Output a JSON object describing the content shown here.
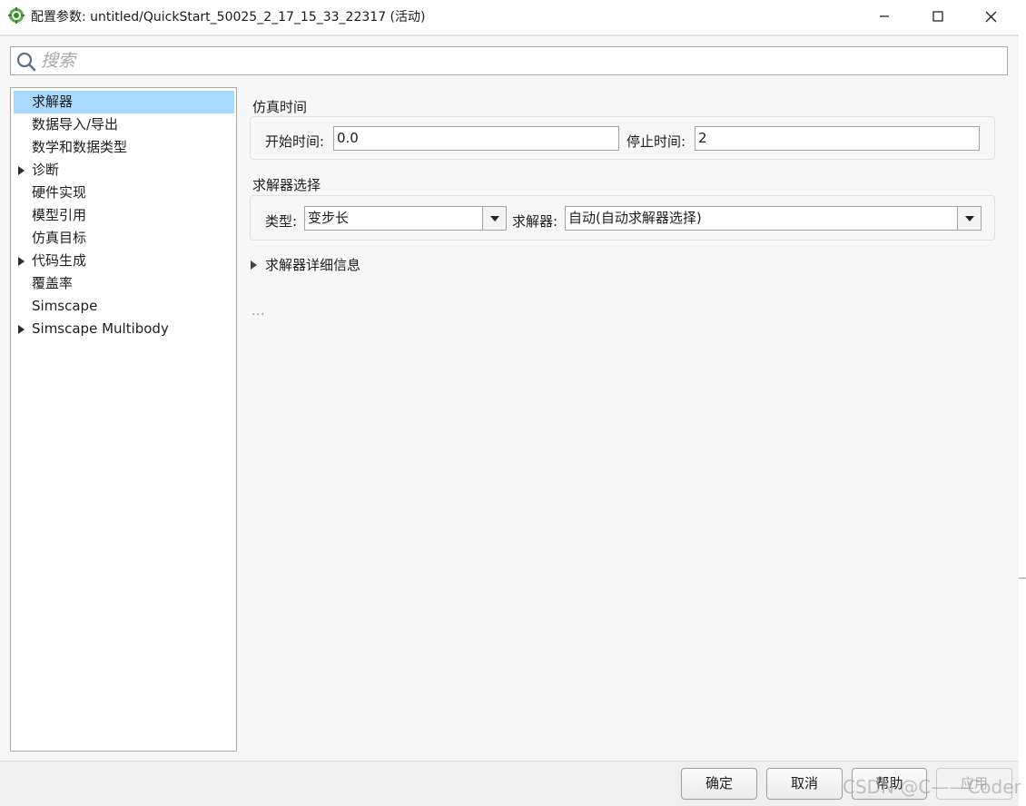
{
  "window": {
    "title": "配置参数: untitled/QuickStart_50025_2_17_15_33_22317 (活动)",
    "app_icon": "matlab-simulink-gear-icon",
    "controls": [
      "minimize-icon",
      "maximize-icon",
      "close-icon"
    ]
  },
  "search": {
    "placeholder": "搜索",
    "value": ""
  },
  "tree": {
    "items": [
      {
        "label": "求解器",
        "expandable": false,
        "selected": true
      },
      {
        "label": "数据导入/导出",
        "expandable": false,
        "selected": false
      },
      {
        "label": "数学和数据类型",
        "expandable": false,
        "selected": false
      },
      {
        "label": "诊断",
        "expandable": true,
        "selected": false
      },
      {
        "label": "硬件实现",
        "expandable": false,
        "selected": false
      },
      {
        "label": "模型引用",
        "expandable": false,
        "selected": false
      },
      {
        "label": "仿真目标",
        "expandable": false,
        "selected": false
      },
      {
        "label": "代码生成",
        "expandable": true,
        "selected": false
      },
      {
        "label": "覆盖率",
        "expandable": false,
        "selected": false
      },
      {
        "label": "Simscape",
        "expandable": false,
        "selected": false
      },
      {
        "label": "Simscape Multibody",
        "expandable": true,
        "selected": false
      }
    ]
  },
  "sim_time": {
    "title": "仿真时间",
    "start_label": "开始时间:",
    "start_value": "0.0",
    "stop_label": "停止时间:",
    "stop_value": "2"
  },
  "solver_selection": {
    "title": "求解器选择",
    "type_label": "类型:",
    "type_value": "变步长",
    "solver_label": "求解器:",
    "solver_value": "自动(自动求解器选择)"
  },
  "solver_details": {
    "label": "求解器详细信息",
    "expanded": false
  },
  "more_indicator": "...",
  "buttons": {
    "ok": "确定",
    "cancel": "取消",
    "help": "帮助",
    "apply": "应用"
  },
  "watermark": "CSDN @C——Coder",
  "colors": {
    "selection": "#a8d9ff",
    "panel_background": "#f7f7f7"
  }
}
